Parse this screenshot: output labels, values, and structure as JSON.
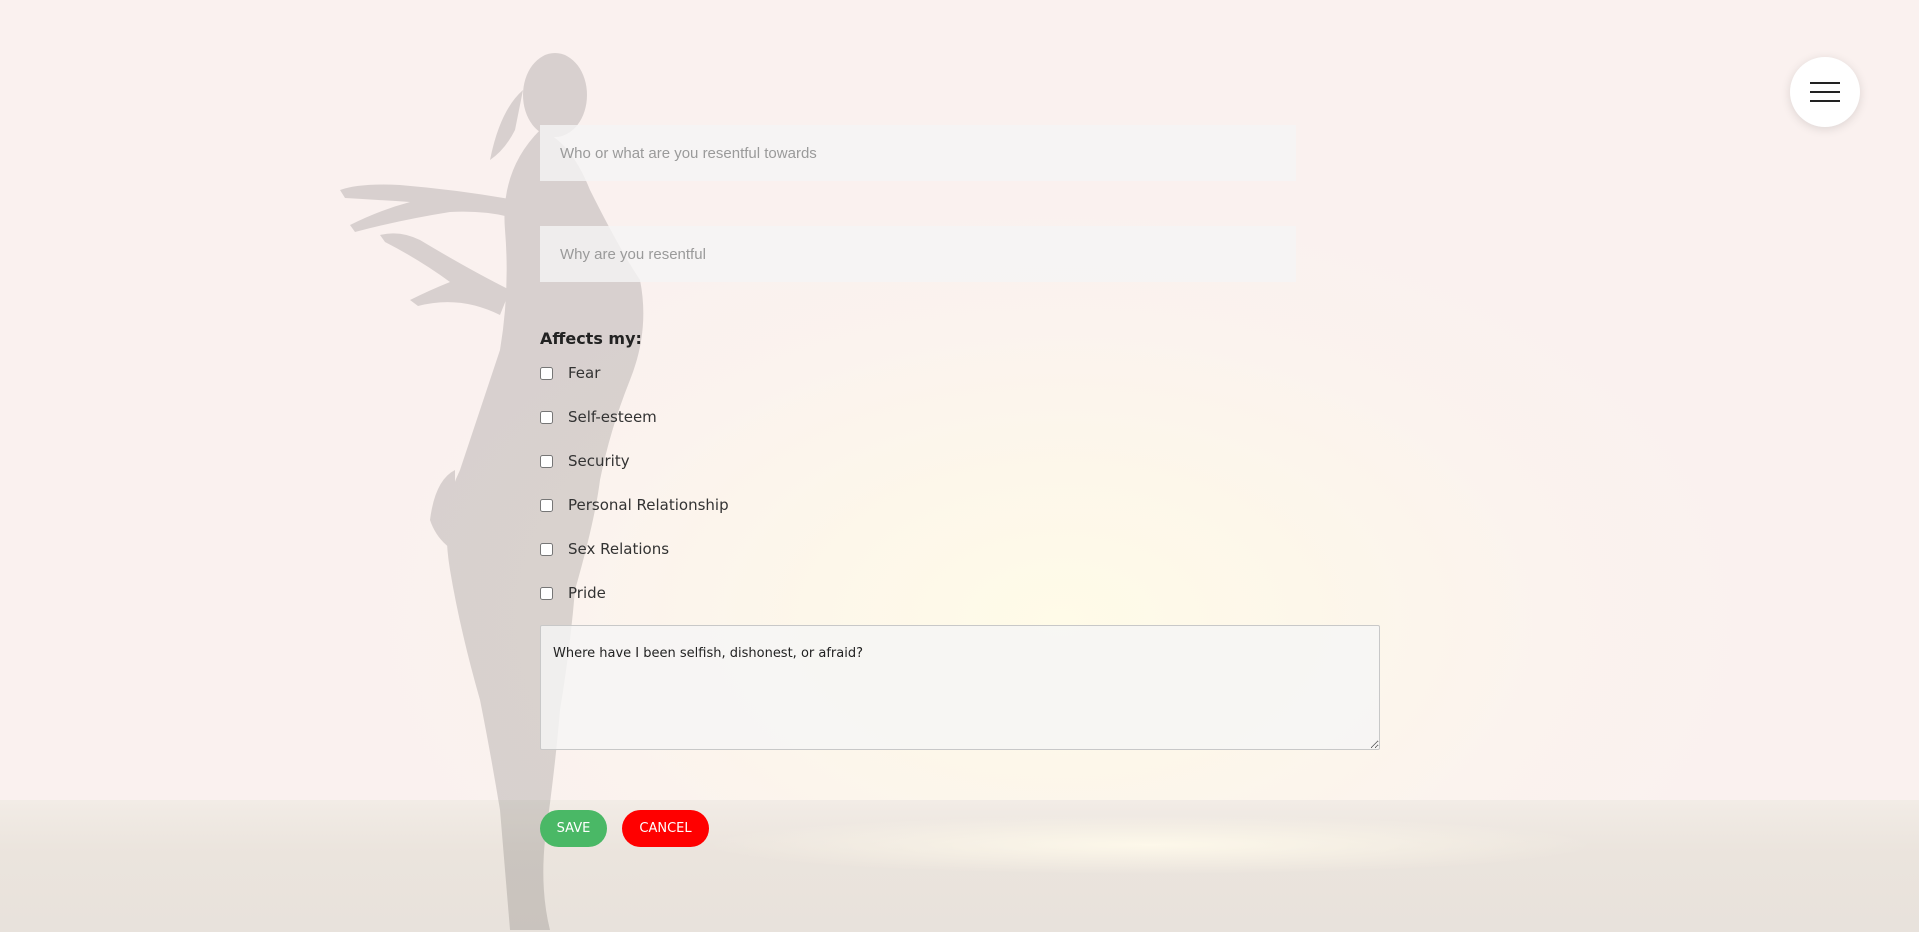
{
  "form": {
    "who_placeholder": "Who or what are you resentful towards",
    "why_placeholder": "Why are you resentful",
    "affects_label": "Affects my:",
    "options": [
      {
        "label": "Fear",
        "checked": false
      },
      {
        "label": "Self-esteem",
        "checked": false
      },
      {
        "label": "Security",
        "checked": false
      },
      {
        "label": "Personal Relationship",
        "checked": false
      },
      {
        "label": "Sex Relations",
        "checked": false
      },
      {
        "label": "Pride",
        "checked": false
      }
    ],
    "notes_value": "Where have I been selfish, dishonest, or afraid?",
    "save_label": "SAVE",
    "cancel_label": "CANCEL"
  },
  "menu": {
    "icon": "hamburger-icon"
  },
  "colors": {
    "save": "#4ab866",
    "cancel": "#ff0000"
  }
}
